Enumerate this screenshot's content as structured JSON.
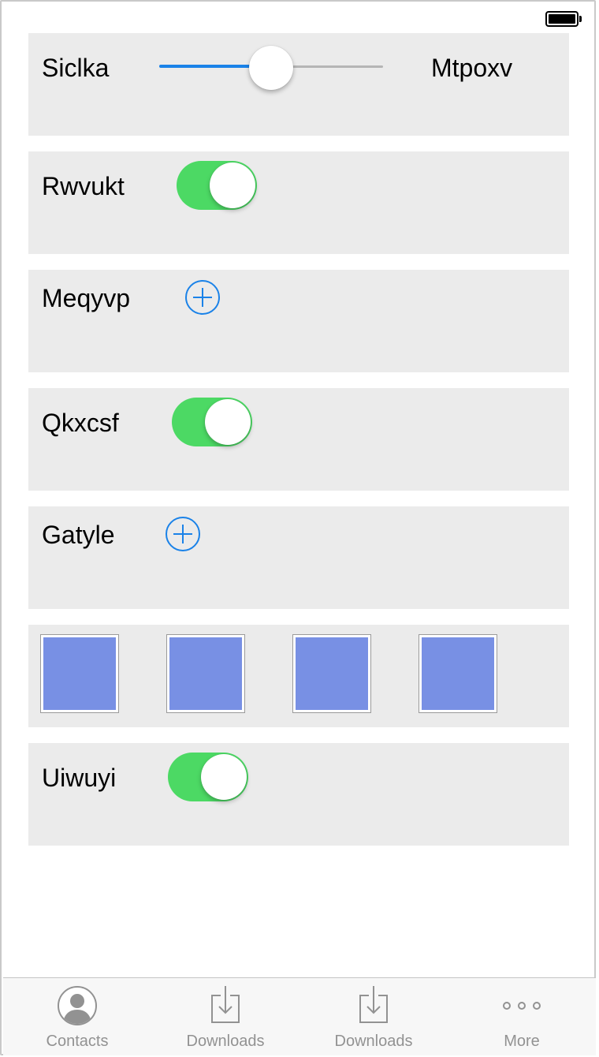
{
  "status_bar": {
    "battery_level": 1.0
  },
  "rows": [
    {
      "type": "slider",
      "label": "Siclka",
      "value_label": "Mtpoxv",
      "slider_value": 0.5
    },
    {
      "type": "toggle",
      "label": "Rwvukt",
      "on": true
    },
    {
      "type": "add",
      "label": "Meqyvp"
    },
    {
      "type": "toggle",
      "label": "Qkxcsf",
      "on": true
    },
    {
      "type": "add",
      "label": "Gatyle"
    },
    {
      "type": "images",
      "count": 4,
      "color": "#7890e4"
    },
    {
      "type": "toggle",
      "label": "Uiwuyi",
      "on": true
    }
  ],
  "tab_bar": {
    "items": [
      {
        "label": "Contacts",
        "icon": "contacts-icon"
      },
      {
        "label": "Downloads",
        "icon": "downloads-icon"
      },
      {
        "label": "Downloads",
        "icon": "downloads-icon"
      },
      {
        "label": "More",
        "icon": "more-icon"
      }
    ]
  },
  "colors": {
    "accent": "#1a82e8",
    "toggle_on": "#4cd964",
    "row_background": "#ebebeb",
    "tab_inactive": "#929292"
  }
}
